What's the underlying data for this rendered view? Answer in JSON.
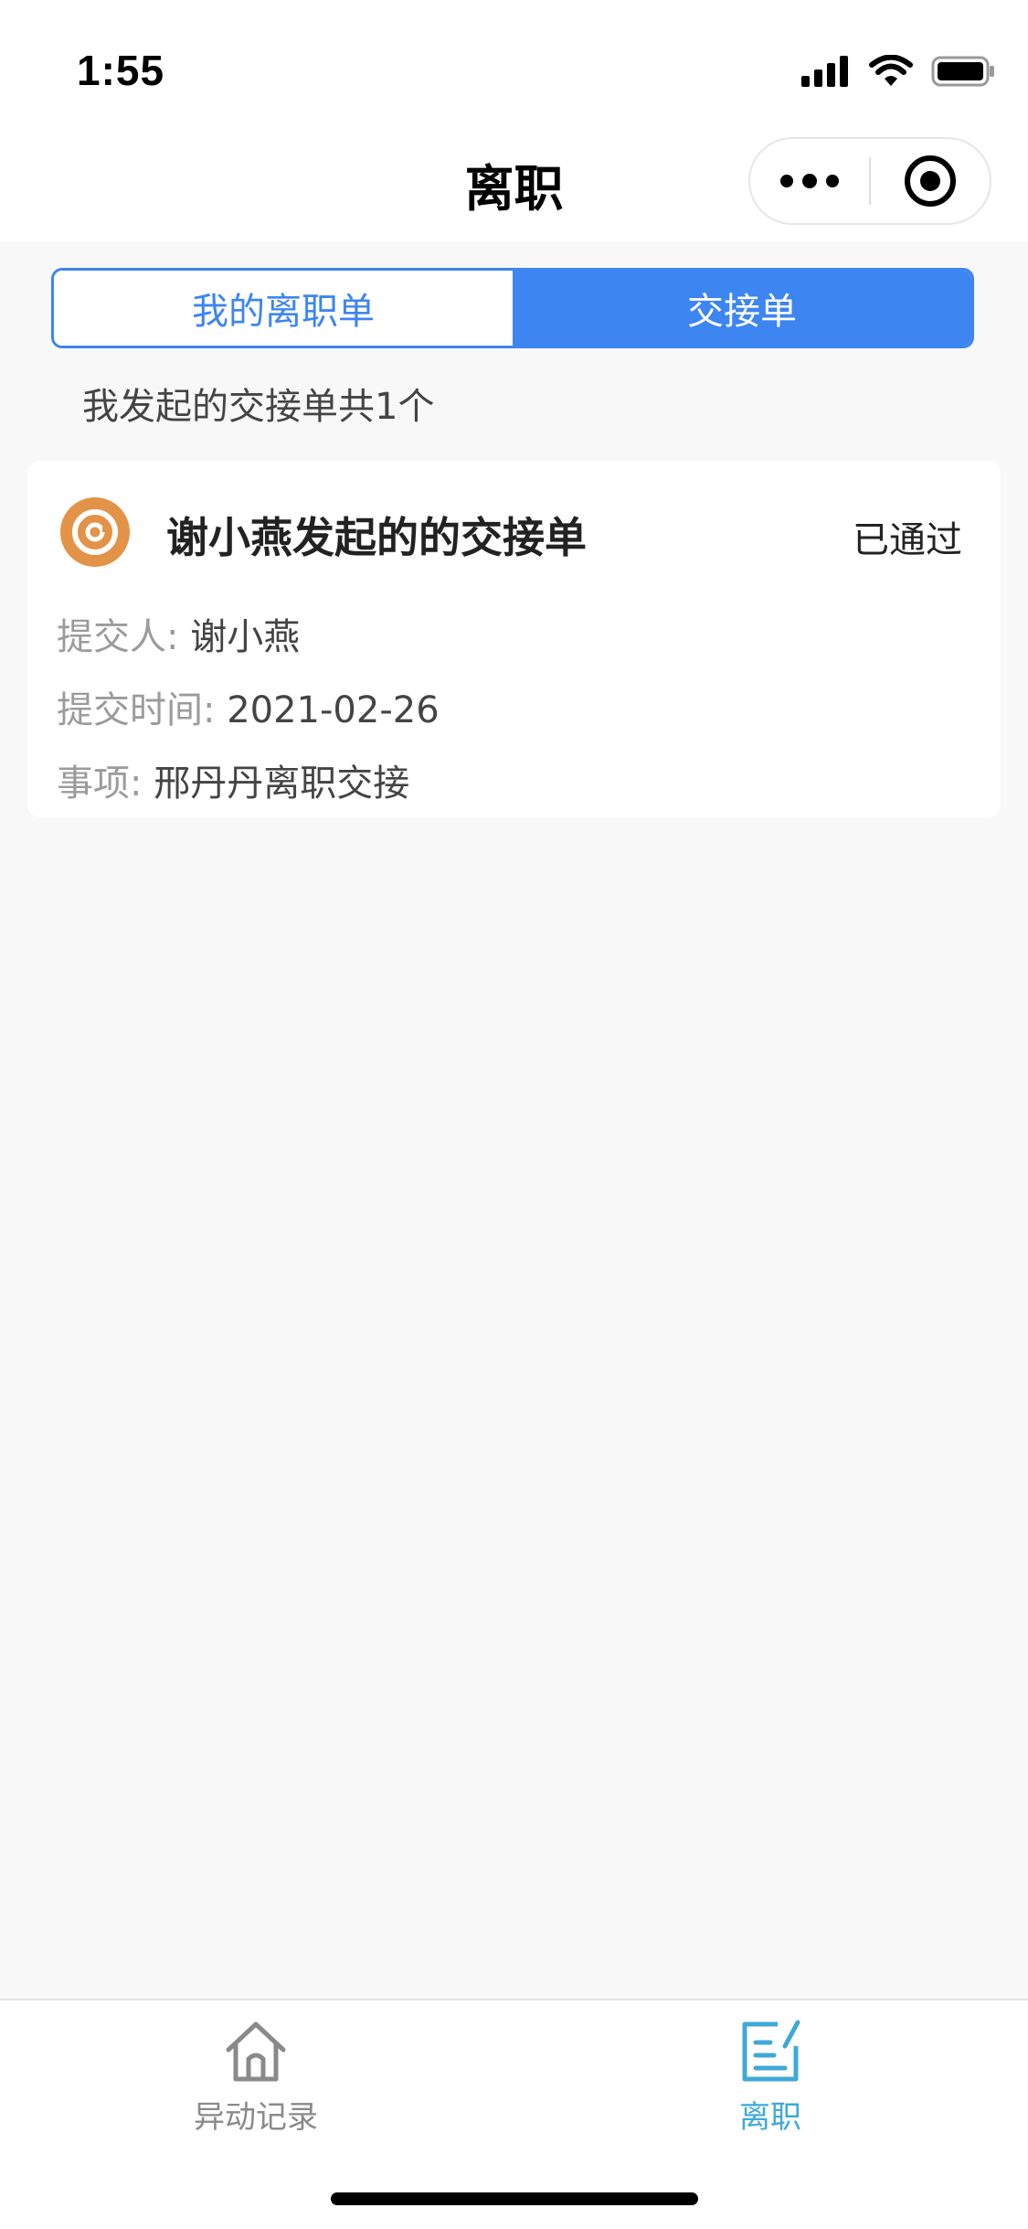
{
  "status_bar": {
    "time": "1:55"
  },
  "nav": {
    "title": "离职"
  },
  "tabs": [
    {
      "label": "我的离职单",
      "active": false
    },
    {
      "label": "交接单",
      "active": true
    }
  ],
  "summary": {
    "text": "我发起的交接单共1个"
  },
  "card": {
    "title": "谢小燕发起的的交接单",
    "status": "已通过",
    "rows": [
      {
        "label": "提交人:",
        "value": "谢小燕"
      },
      {
        "label": "提交时间:",
        "value": "2021-02-26"
      },
      {
        "label": "事项:",
        "value": "邢丹丹离职交接"
      }
    ]
  },
  "tab_bar": {
    "items": [
      {
        "label": "异动记录",
        "icon": "home-icon",
        "active": false
      },
      {
        "label": "离职",
        "icon": "edit-document-icon",
        "active": true
      }
    ]
  },
  "colors": {
    "accent": "#3d85f0",
    "tabbar_active": "#3fa9d6",
    "tabbar_inactive": "#8a8a8a",
    "card_icon": "#e39347"
  }
}
